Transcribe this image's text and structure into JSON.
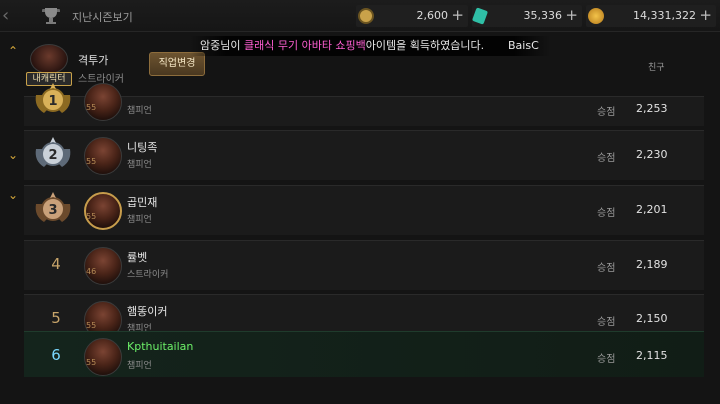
{
  "topbar": {
    "season_link": "지난시즌보기",
    "currencies": [
      {
        "icon": "coin-c-icon",
        "value": "2,600",
        "color": "#c9a24a"
      },
      {
        "icon": "gem-icon",
        "value": "35,336",
        "color": "#2fbfa6"
      },
      {
        "icon": "gold-icon",
        "value": "14,331,322",
        "color": "#e0a52a"
      }
    ]
  },
  "notice": {
    "pre": "암중님이 ",
    "highlight": "클래식 무기 아바타 쇼핑백",
    "post": "아이템을 획득하였습니다.",
    "sender": "BaisC",
    "highlight_color": "#ff5fd2"
  },
  "friend_tab": "친구",
  "my_character": {
    "badge": "내캐릭터",
    "class_title": "격투가",
    "class_sub": "스트라이커",
    "change_job": "직업변경"
  },
  "win_label": "승점",
  "rows": [
    {
      "rank": "1",
      "medal": "gold",
      "name": "",
      "level": "55",
      "cls": "챔피언",
      "score": "2,253"
    },
    {
      "rank": "2",
      "medal": "silver",
      "name": "니팅족",
      "level": "55",
      "cls": "챔피언",
      "score": "2,230"
    },
    {
      "rank": "3",
      "medal": "bronze",
      "name": "곱민재",
      "level": "55",
      "cls": "챔피언",
      "score": "2,201"
    },
    {
      "rank": "4",
      "medal": "",
      "name": "률벳",
      "level": "46",
      "cls": "스트라이커",
      "score": "2,189"
    },
    {
      "rank": "5",
      "medal": "",
      "name": "햄똥이커",
      "level": "55",
      "cls": "챔피언",
      "score": "2,150"
    },
    {
      "rank": "6",
      "medal": "",
      "name": "Kpthuitailan",
      "level": "55",
      "cls": "챔피언",
      "score": "2,115",
      "is_me": true
    }
  ]
}
